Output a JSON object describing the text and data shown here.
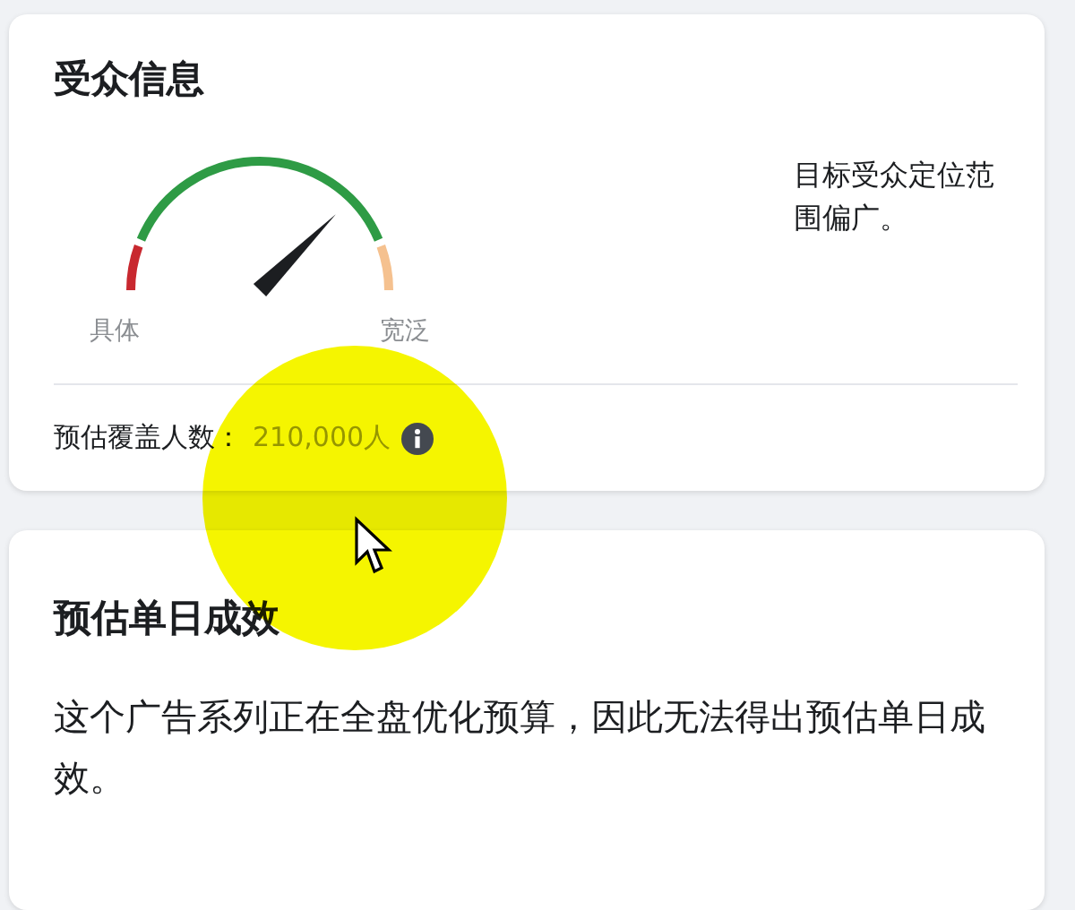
{
  "audience": {
    "title": "受众信息",
    "gauge": {
      "min_label": "具体",
      "max_label": "宽泛"
    },
    "summary": "目标受众定位范围偏广。",
    "reach_label": "预估覆盖人数：",
    "reach_value": "210,000人"
  },
  "daily_results": {
    "title": "预估单日成效",
    "message": "这个广告系列正在全盘优化预算，因此无法得出预估单日成效。"
  }
}
